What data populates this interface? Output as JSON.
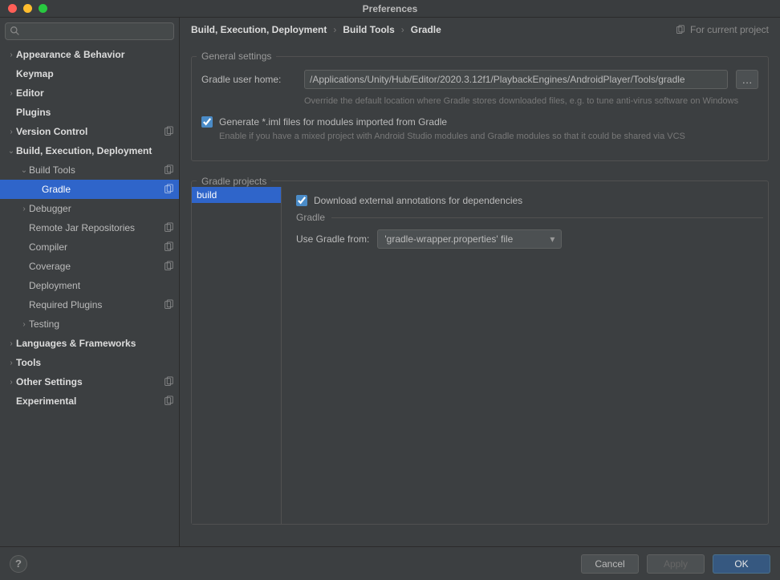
{
  "window": {
    "title": "Preferences"
  },
  "search": {
    "placeholder": ""
  },
  "sidebar": {
    "items": [
      {
        "label": "Appearance & Behavior",
        "depth": 0,
        "expandable": true,
        "expanded": false,
        "bold": true,
        "badge": false
      },
      {
        "label": "Keymap",
        "depth": 0,
        "expandable": false,
        "bold": true,
        "badge": false
      },
      {
        "label": "Editor",
        "depth": 0,
        "expandable": true,
        "expanded": false,
        "bold": true,
        "badge": false
      },
      {
        "label": "Plugins",
        "depth": 0,
        "expandable": false,
        "bold": true,
        "badge": false
      },
      {
        "label": "Version Control",
        "depth": 0,
        "expandable": true,
        "expanded": false,
        "bold": true,
        "badge": true
      },
      {
        "label": "Build, Execution, Deployment",
        "depth": 0,
        "expandable": true,
        "expanded": true,
        "bold": true,
        "badge": false
      },
      {
        "label": "Build Tools",
        "depth": 1,
        "expandable": true,
        "expanded": true,
        "bold": false,
        "badge": true
      },
      {
        "label": "Gradle",
        "depth": 2,
        "expandable": false,
        "bold": false,
        "badge": true,
        "selected": true
      },
      {
        "label": "Debugger",
        "depth": 1,
        "expandable": true,
        "expanded": false,
        "bold": false,
        "badge": false
      },
      {
        "label": "Remote Jar Repositories",
        "depth": 1,
        "expandable": false,
        "bold": false,
        "badge": true
      },
      {
        "label": "Compiler",
        "depth": 1,
        "expandable": false,
        "bold": false,
        "badge": true
      },
      {
        "label": "Coverage",
        "depth": 1,
        "expandable": false,
        "bold": false,
        "badge": true
      },
      {
        "label": "Deployment",
        "depth": 1,
        "expandable": false,
        "bold": false,
        "badge": false
      },
      {
        "label": "Required Plugins",
        "depth": 1,
        "expandable": false,
        "bold": false,
        "badge": true
      },
      {
        "label": "Testing",
        "depth": 1,
        "expandable": true,
        "expanded": false,
        "bold": false,
        "badge": false
      },
      {
        "label": "Languages & Frameworks",
        "depth": 0,
        "expandable": true,
        "expanded": false,
        "bold": true,
        "badge": false
      },
      {
        "label": "Tools",
        "depth": 0,
        "expandable": true,
        "expanded": false,
        "bold": true,
        "badge": false
      },
      {
        "label": "Other Settings",
        "depth": 0,
        "expandable": true,
        "expanded": false,
        "bold": true,
        "badge": true
      },
      {
        "label": "Experimental",
        "depth": 0,
        "expandable": false,
        "bold": true,
        "badge": true
      }
    ]
  },
  "breadcrumb": {
    "parts": [
      "Build, Execution, Deployment",
      "Build Tools",
      "Gradle"
    ],
    "scope": "For current project"
  },
  "general": {
    "legend": "General settings",
    "homeLabel": "Gradle user home:",
    "homeValue": "/Applications/Unity/Hub/Editor/2020.3.12f1/PlaybackEngines/AndroidPlayer/Tools/gradle",
    "homeHint": "Override the default location where Gradle stores downloaded files, e.g. to tune anti-virus software on Windows",
    "imlLabel": "Generate *.iml files for modules imported from Gradle",
    "imlHint": "Enable if you have a mixed project with Android Studio modules and Gradle modules so that it could be shared via VCS"
  },
  "projects": {
    "legend": "Gradle projects",
    "list": [
      "build"
    ],
    "downloadAnnotations": "Download external annotations for dependencies",
    "gradleSub": "Gradle",
    "useFromLabel": "Use Gradle from:",
    "useFromValue": "'gradle-wrapper.properties' file"
  },
  "footer": {
    "cancel": "Cancel",
    "apply": "Apply",
    "ok": "OK"
  }
}
